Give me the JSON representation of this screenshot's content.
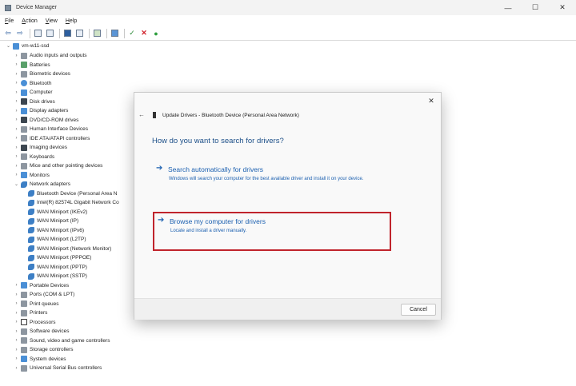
{
  "window": {
    "title": "Device Manager",
    "controls": {
      "minimize": "—",
      "maximize": "☐",
      "close": "✕"
    }
  },
  "menu": [
    {
      "label": "File",
      "accel": "F",
      "rest": "ile"
    },
    {
      "label": "Action",
      "accel": "A",
      "rest": "ction"
    },
    {
      "label": "View",
      "accel": "V",
      "rest": "iew"
    },
    {
      "label": "Help",
      "accel": "H",
      "rest": "elp"
    }
  ],
  "toolbar": {
    "back": "back-arrow-icon",
    "forward": "forward-arrow-icon",
    "scan_glyph": "✓",
    "remove_glyph": "✕",
    "update_glyph": "●",
    "colors": {
      "scan": "#2e8b3a",
      "remove": "#d0202a",
      "update": "#2e9e3e"
    }
  },
  "tree": {
    "root": "vm-w11-ssd",
    "categories": [
      "Audio inputs and outputs",
      "Batteries",
      "Biometric devices",
      "Bluetooth",
      "Computer",
      "Disk drives",
      "Display adapters",
      "DVD/CD-ROM drives",
      "Human Interface Devices",
      "IDE ATA/ATAPI controllers",
      "Imaging devices",
      "Keyboards",
      "Mice and other pointing devices",
      "Monitors",
      "Network adapters"
    ],
    "network_adapters": [
      "Bluetooth Device (Personal Area N",
      "Intel(R) 82574L Gigabit Network Co",
      "WAN Miniport (IKEv2)",
      "WAN Miniport (IP)",
      "WAN Miniport (IPv6)",
      "WAN Miniport (L2TP)",
      "WAN Miniport (Network Monitor)",
      "WAN Miniport (PPPOE)",
      "WAN Miniport (PPTP)",
      "WAN Miniport (SSTP)"
    ],
    "categories_after": [
      "Portable Devices",
      "Ports (COM & LPT)",
      "Print queues",
      "Printers",
      "Processors",
      "Software devices",
      "Sound, video and game controllers",
      "Storage controllers",
      "System devices",
      "Universal Serial Bus controllers"
    ]
  },
  "dialog": {
    "title": "Update Drivers - Bluetooth Device (Personal Area Network)",
    "question": "How do you want to search for drivers?",
    "options": [
      {
        "title": "Search automatically for drivers",
        "description": "Windows will search your computer for the best available driver and install it on your device."
      },
      {
        "title": "Browse my computer for drivers",
        "description": "Locate and install a driver manually."
      }
    ],
    "cancel_label": "Cancel",
    "highlight_color": "#c0242c"
  }
}
